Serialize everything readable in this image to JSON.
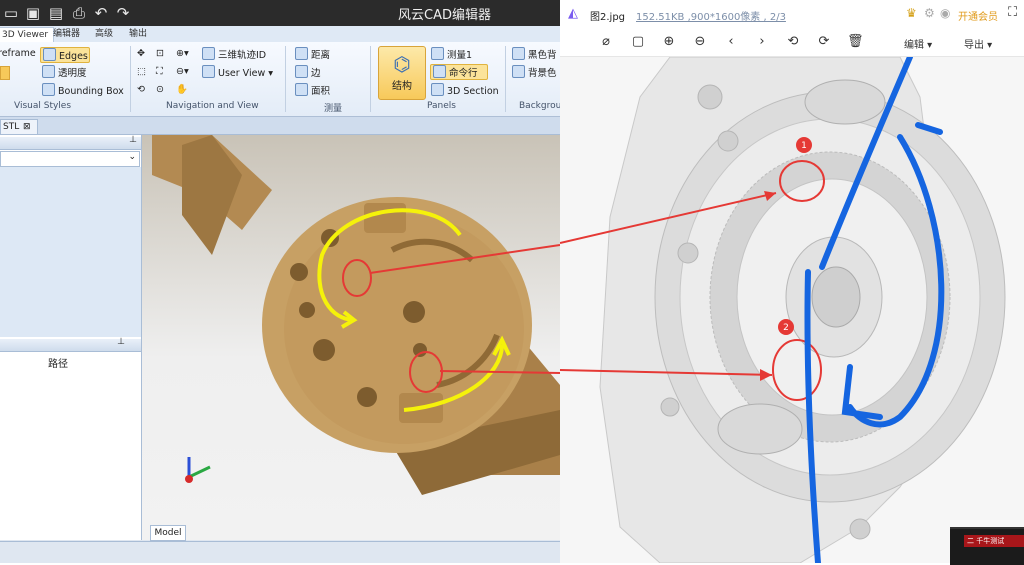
{
  "cad": {
    "title": "风云CAD编辑器",
    "tabs": [
      "3D Viewer",
      "编辑器",
      "高级",
      "输出"
    ],
    "ribbon": {
      "visual_styles": {
        "wireframe": "reframe",
        "edges": "Edges",
        "transparency": "透明度",
        "bounding_box": "Bounding Box",
        "label": "Visual Styles"
      },
      "navigation": {
        "orbit": "三维轨迹ID",
        "user_view": "User View",
        "label": "Navigation and View"
      },
      "measure": {
        "distance": "距离",
        "edge": "边",
        "area": "面积",
        "label": "测量"
      },
      "panels": {
        "structure": "结构",
        "measure1": "测量1",
        "command_line": "命令行",
        "section": "3D Section",
        "label": "Panels"
      },
      "background": {
        "black_bg": "黑色背",
        "bg_color": "背景色",
        "label": "Backgrou"
      }
    },
    "doc_tab": "STL",
    "left_panel": {
      "path_header": "路径"
    },
    "model_tab": "Model"
  },
  "viewer": {
    "file_name": "图2.jpg",
    "file_info": "152.51KB ,900*1600像素 , 2/3",
    "vip": "开通会员",
    "edit": "编辑",
    "export": "导出",
    "markers": [
      "1",
      "2"
    ],
    "mini_window_text": "二 千牛测试"
  },
  "colors": {
    "model_gold": "#c39a5e",
    "annotation_yellow": "#f5f20a",
    "annotation_red": "#e53935",
    "annotation_blue": "#1565e0",
    "ribbon_highlight": "#fbe39a"
  }
}
